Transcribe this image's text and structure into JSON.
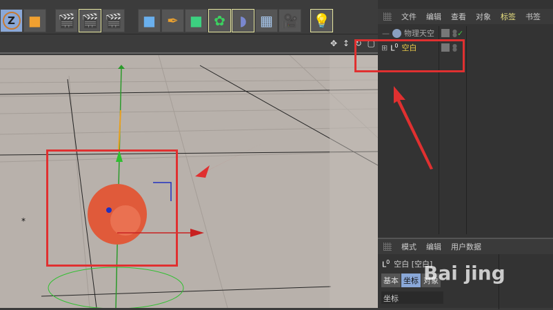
{
  "toolbar": {
    "icons": [
      "z-mode-icon",
      "axis-icon",
      "render-view-icon",
      "render-picture-icon",
      "render-settings-icon",
      "cube-icon",
      "pen-icon",
      "subdivision-icon",
      "array-icon",
      "bend-icon",
      "floor-icon",
      "camera-icon",
      "light-icon"
    ]
  },
  "object_manager": {
    "menu": [
      "文件",
      "编辑",
      "查看",
      "对象",
      "标签",
      "书签"
    ],
    "active_menu": "标签",
    "objects": [
      {
        "name": "物理天空",
        "check": "✓"
      },
      {
        "name": "空白"
      }
    ]
  },
  "attributes": {
    "menu": [
      "模式",
      "编辑",
      "用户数据"
    ],
    "object_title": "空白 [空白]",
    "tabs": [
      "基本",
      "坐标",
      "对象"
    ],
    "active_tab": "坐标",
    "section": "坐标"
  },
  "watermark": {
    "text": "Bai jing"
  },
  "colors": {
    "accent": "#e8c84a",
    "red": "#e03030",
    "sphere": "#e05a3a"
  }
}
